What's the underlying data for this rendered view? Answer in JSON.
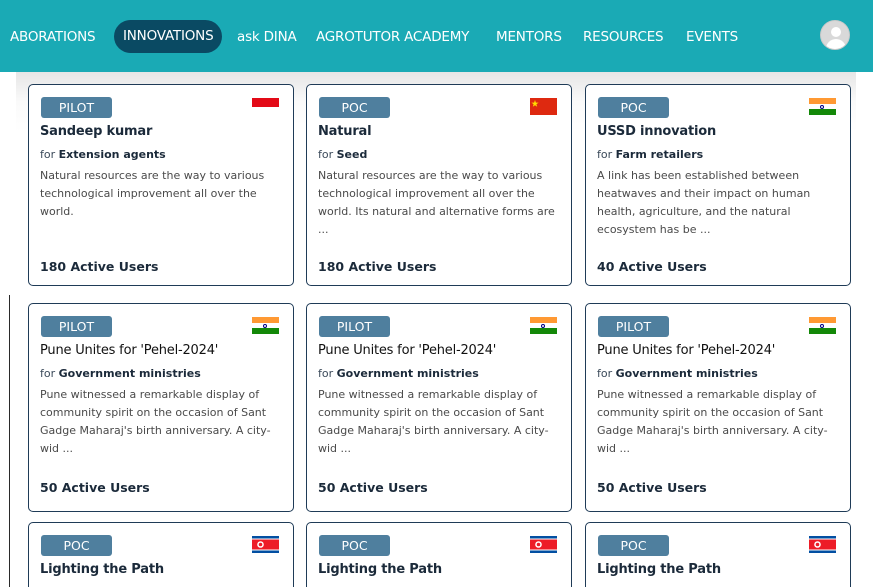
{
  "nav": {
    "items": [
      {
        "label": "ABORATIONS"
      },
      {
        "label": "INNOVATIONS",
        "active": true
      },
      {
        "label": "ask DINA"
      },
      {
        "label": "AGROTUTOR ACADEMY"
      },
      {
        "label": "MENTORS"
      },
      {
        "label": "RESOURCES"
      },
      {
        "label": "EVENTS"
      }
    ]
  },
  "colors": {
    "navbar": "#1aaab5",
    "active_tab": "#0a4a63",
    "badge": "#4f7f9e",
    "card_border": "#1f3b57"
  },
  "for_prefix": "for",
  "cards": [
    {
      "badge": "PILOT",
      "flag": "indonesia",
      "title": "Sandeep kumar",
      "audience": "Extension agents",
      "description": "Natural resources are the way to various technological improvement all over the world.",
      "users": "180 Active Users"
    },
    {
      "badge": "POC",
      "flag": "china",
      "title": "Natural",
      "audience": "Seed",
      "description": "Natural resources are the way to various technological improvement all over the world. Its natural and alternative forms are ...",
      "users": "180 Active Users"
    },
    {
      "badge": "POC",
      "flag": "india",
      "title": "USSD innovation",
      "audience": "Farm retailers",
      "description": "A link has been established between heatwaves and their impact on human health, agriculture, and the natural ecosystem has be ...",
      "users": "40 Active Users"
    },
    {
      "badge": "PILOT",
      "flag": "india",
      "title": "Pune Unites for 'Pehel-2024'",
      "audience": "Government ministries",
      "description": "Pune witnessed a remarkable display of community spirit on the occasion of Sant Gadge Maharaj's birth anniversary. A city-wid ...",
      "users": "50 Active Users"
    },
    {
      "badge": "PILOT",
      "flag": "india",
      "title": "Pune Unites for 'Pehel-2024'",
      "audience": "Government ministries",
      "description": "Pune witnessed a remarkable display of community spirit on the occasion of Sant Gadge Maharaj's birth anniversary. A city-wid ...",
      "users": "50 Active Users"
    },
    {
      "badge": "PILOT",
      "flag": "india",
      "title": "Pune Unites for 'Pehel-2024'",
      "audience": "Government ministries",
      "description": "Pune witnessed a remarkable display of community spirit on the occasion of Sant Gadge Maharaj's birth anniversary. A city-wid ...",
      "users": "50 Active Users"
    },
    {
      "badge": "POC",
      "flag": "north-korea",
      "title": "Lighting the Path",
      "audience": "",
      "description": "",
      "users": ""
    },
    {
      "badge": "POC",
      "flag": "north-korea",
      "title": "Lighting the Path",
      "audience": "",
      "description": "",
      "users": ""
    },
    {
      "badge": "POC",
      "flag": "north-korea",
      "title": "Lighting the Path",
      "audience": "",
      "description": "",
      "users": ""
    }
  ]
}
